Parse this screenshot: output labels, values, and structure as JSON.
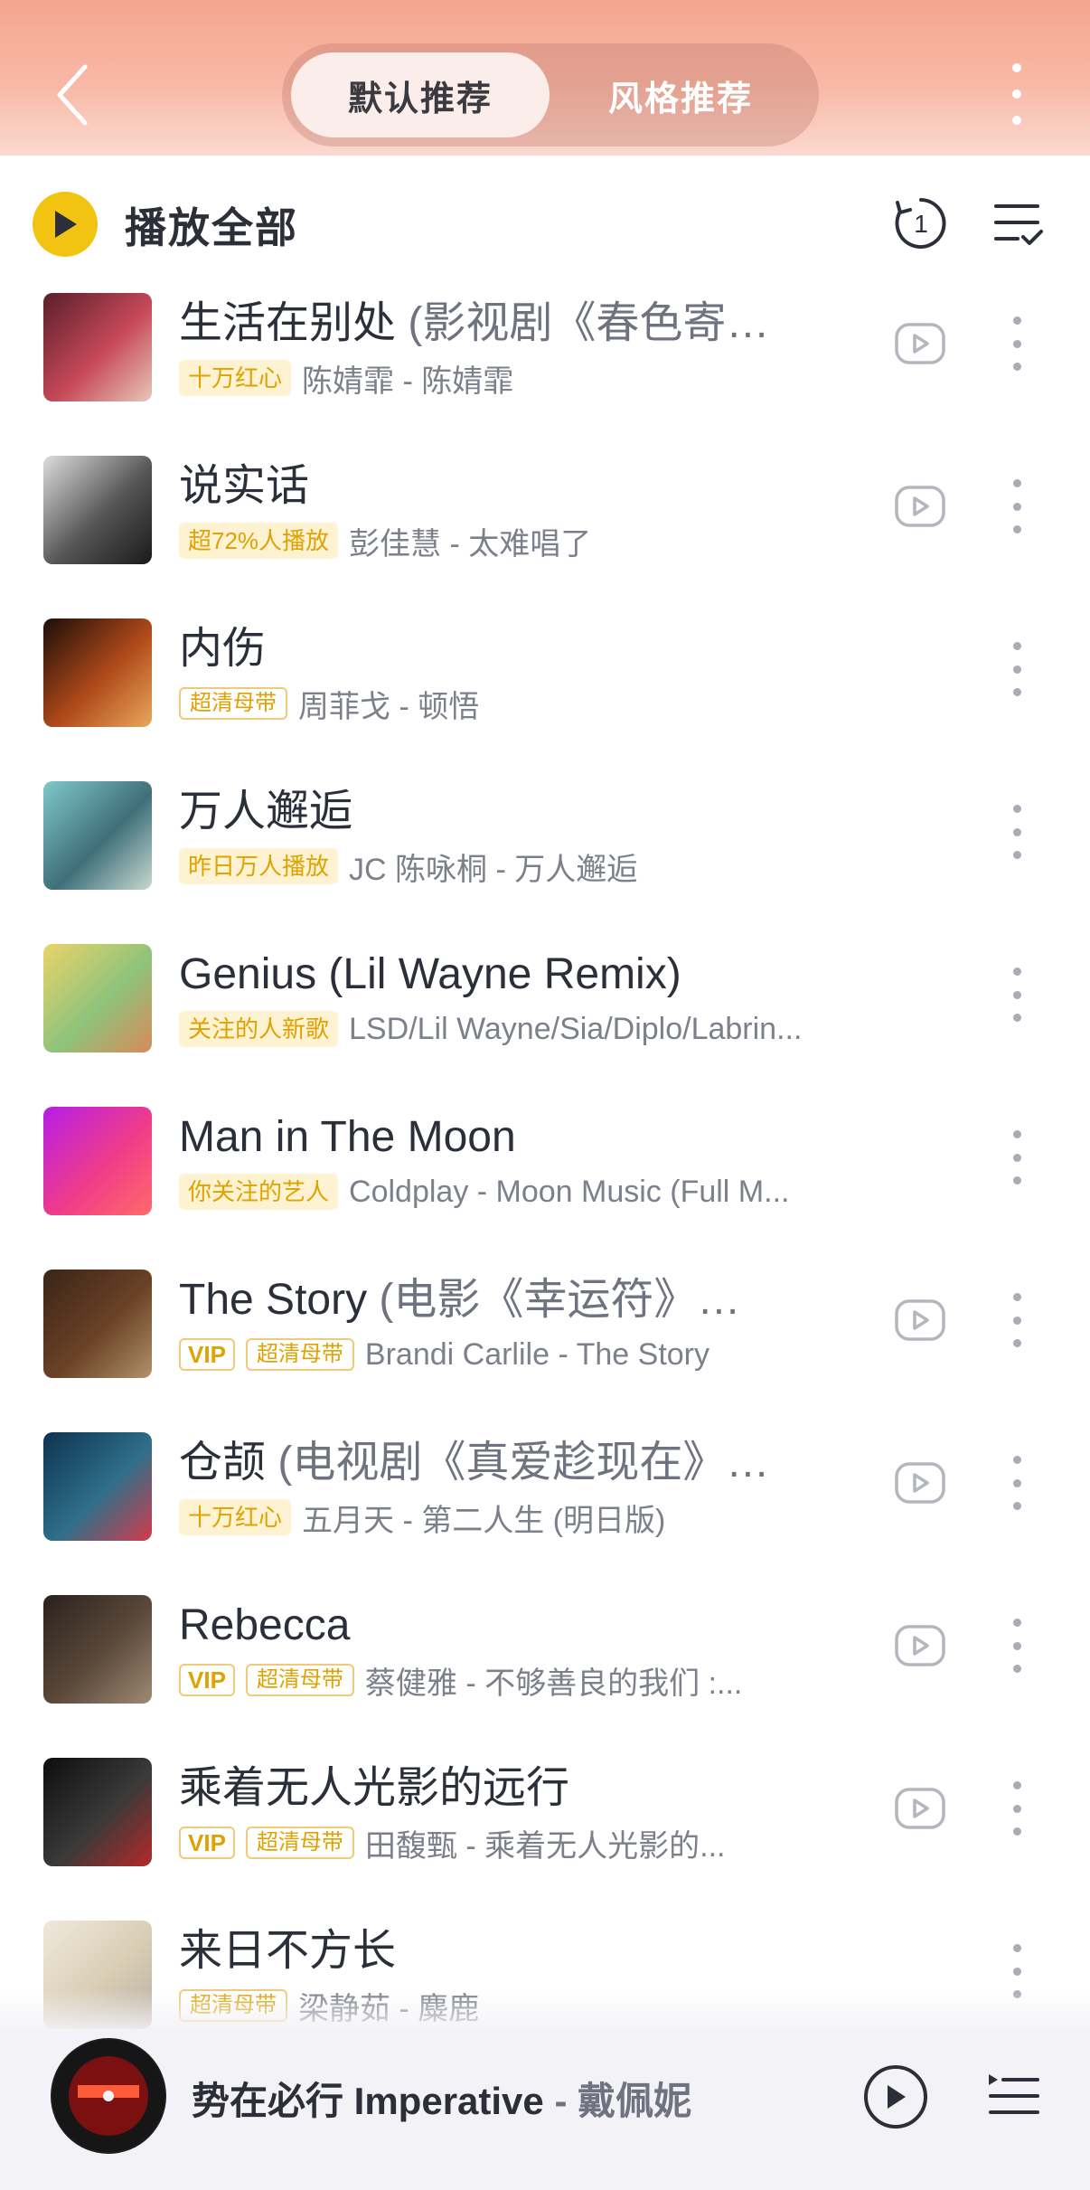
{
  "header": {
    "tabs": [
      {
        "label": "默认推荐",
        "active": true
      },
      {
        "label": "风格推荐",
        "active": false
      }
    ]
  },
  "toolbar": {
    "play_all_label": "播放全部",
    "history_badge": "1"
  },
  "songs": [
    {
      "title": "生活在别处",
      "title_sub": " (影视剧《春色寄…",
      "tags": [
        {
          "text": "十万红心",
          "style": "fill"
        }
      ],
      "artist": "陈婧霏 - 陈婧霏",
      "has_mv": true,
      "cover": [
        "#5a1e2a",
        "#c7495a",
        "#e7c7b8"
      ]
    },
    {
      "title": "说实话",
      "title_sub": "",
      "tags": [
        {
          "text": "超72%人播放",
          "style": "fill"
        }
      ],
      "artist": "彭佳慧 - 太难唱了",
      "has_mv": true,
      "cover": [
        "#dcdcdc",
        "#555555",
        "#1a1a1a"
      ]
    },
    {
      "title": "内伤",
      "title_sub": "",
      "tags": [
        {
          "text": "超清母带",
          "style": "outline"
        }
      ],
      "artist": "周菲戈 - 顿悟",
      "has_mv": false,
      "cover": [
        "#1b0e08",
        "#b14a1c",
        "#e9a85a"
      ]
    },
    {
      "title": "万人邂逅",
      "title_sub": "",
      "tags": [
        {
          "text": "昨日万人播放",
          "style": "fill"
        }
      ],
      "artist": "JC 陈咏桐 - 万人邂逅",
      "has_mv": false,
      "cover": [
        "#7fc8c8",
        "#3f6f7a",
        "#c8d8d0"
      ]
    },
    {
      "title": "Genius (Lil Wayne Remix)",
      "title_sub": "",
      "tags": [
        {
          "text": "关注的人新歌",
          "style": "fill"
        }
      ],
      "artist": "LSD/Lil Wayne/Sia/Diplo/Labrin...",
      "has_mv": false,
      "cover": [
        "#e9d36a",
        "#8fc37a",
        "#d78a5a"
      ]
    },
    {
      "title": "Man in The Moon",
      "title_sub": "",
      "tags": [
        {
          "text": "你关注的艺人",
          "style": "fill"
        }
      ],
      "artist": "Coldplay - Moon Music (Full M...",
      "has_mv": false,
      "cover": [
        "#b51ee6",
        "#f03b8a",
        "#ff6a6a"
      ]
    },
    {
      "title": "The Story",
      "title_sub": " (电影《幸运符》…",
      "tags": [
        {
          "text": "VIP",
          "style": "vip"
        },
        {
          "text": "超清母带",
          "style": "outline"
        }
      ],
      "artist": "Brandi Carlile - The Story",
      "has_mv": true,
      "cover": [
        "#3a2418",
        "#6b4226",
        "#b0916a"
      ]
    },
    {
      "title": "仓颉",
      "title_sub": " (电视剧《真爱趁现在》…",
      "tags": [
        {
          "text": "十万红心",
          "style": "fill"
        }
      ],
      "artist": "五月天 - 第二人生 (明日版)",
      "has_mv": true,
      "cover": [
        "#0f3350",
        "#2e6f8a",
        "#d43a4a"
      ]
    },
    {
      "title": "Rebecca",
      "title_sub": "",
      "tags": [
        {
          "text": "VIP",
          "style": "vip"
        },
        {
          "text": "超清母带",
          "style": "outline"
        }
      ],
      "artist": "蔡健雅 - 不够善良的我们 :...",
      "has_mv": true,
      "cover": [
        "#2a211c",
        "#5c4a3c",
        "#a08a74"
      ]
    },
    {
      "title": "乘着无人光影的远行",
      "title_sub": "",
      "tags": [
        {
          "text": "VIP",
          "style": "vip"
        },
        {
          "text": "超清母带",
          "style": "outline"
        }
      ],
      "artist": "田馥甄 - 乘着无人光影的...",
      "has_mv": true,
      "cover": [
        "#0e0e0e",
        "#3a3a3a",
        "#b42a2a"
      ]
    },
    {
      "title": "来日不方长",
      "title_sub": "",
      "tags": [
        {
          "text": "超清母带",
          "style": "outline"
        }
      ],
      "artist": "梁静茹 - 麋鹿",
      "has_mv": false,
      "cover": [
        "#efe9dc",
        "#d9cdb5",
        "#b9b0a2"
      ]
    }
  ],
  "player": {
    "title": "势在必行 Imperative",
    "artist": " - 戴佩妮"
  }
}
